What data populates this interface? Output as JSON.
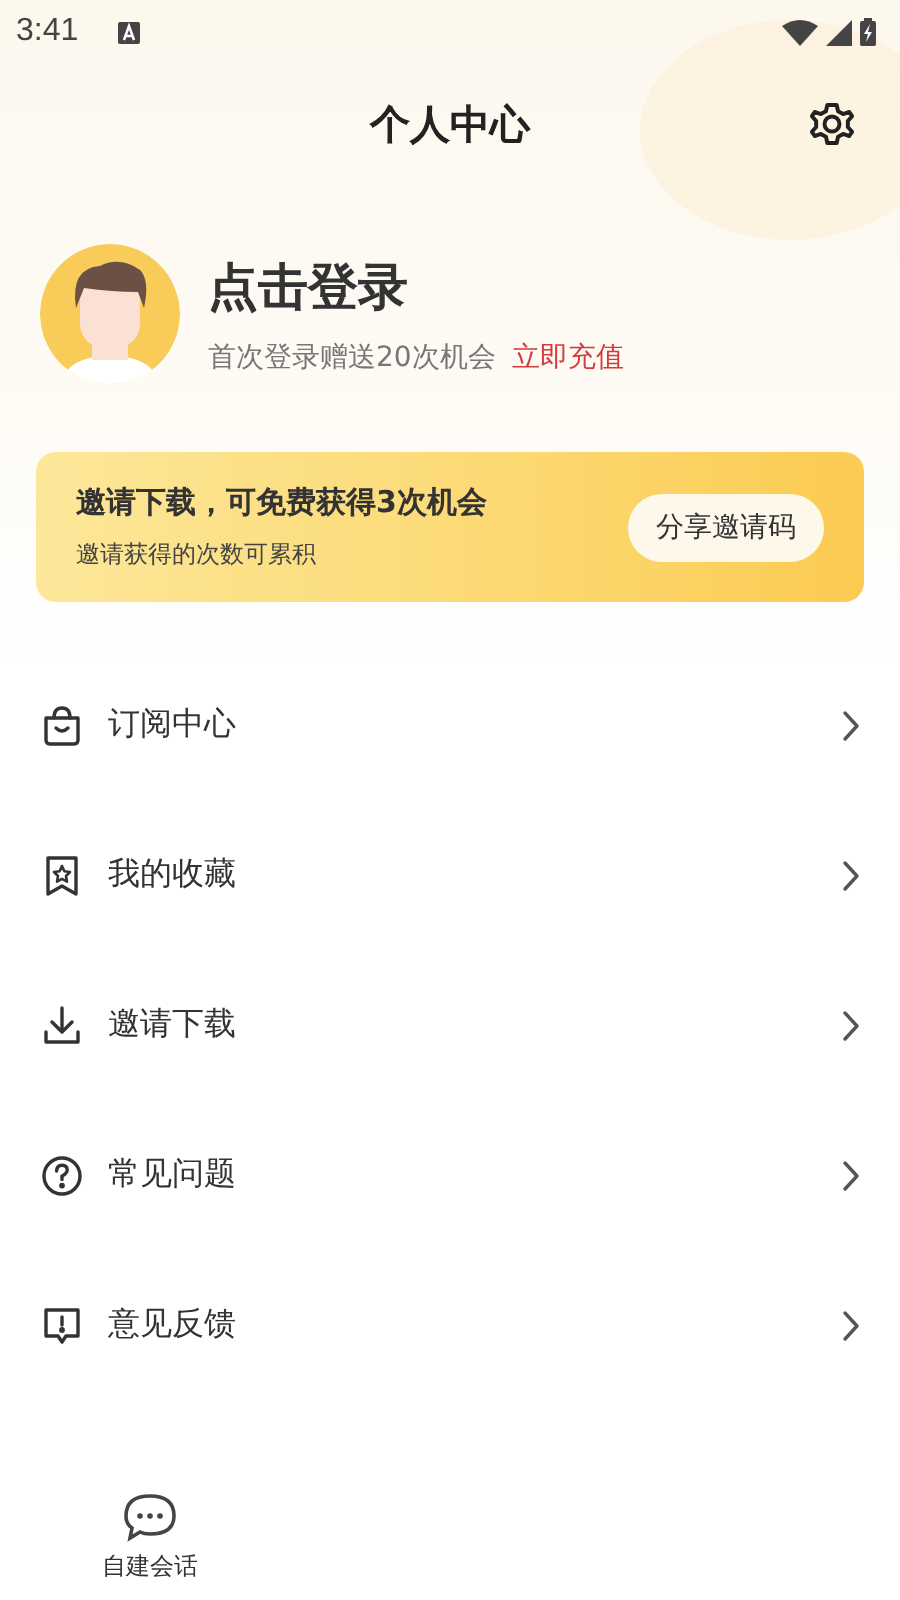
{
  "status_bar": {
    "time": "3:41"
  },
  "header": {
    "title": "个人中心"
  },
  "profile": {
    "name": "点击登录",
    "note": "首次登录赠送20次机会",
    "link": "立即充值"
  },
  "invite_banner": {
    "title": "邀请下载，可免费获得3次机会",
    "subtitle": "邀请获得的次数可累积",
    "button": "分享邀请码"
  },
  "menu": [
    {
      "kind": "bag",
      "label": "订阅中心"
    },
    {
      "kind": "bookmark",
      "label": "我的收藏"
    },
    {
      "kind": "download",
      "label": "邀请下载"
    },
    {
      "kind": "question",
      "label": "常见问题"
    },
    {
      "kind": "feedback",
      "label": "意见反馈"
    }
  ],
  "bottom_nav": [
    {
      "label": "自建会话"
    }
  ]
}
